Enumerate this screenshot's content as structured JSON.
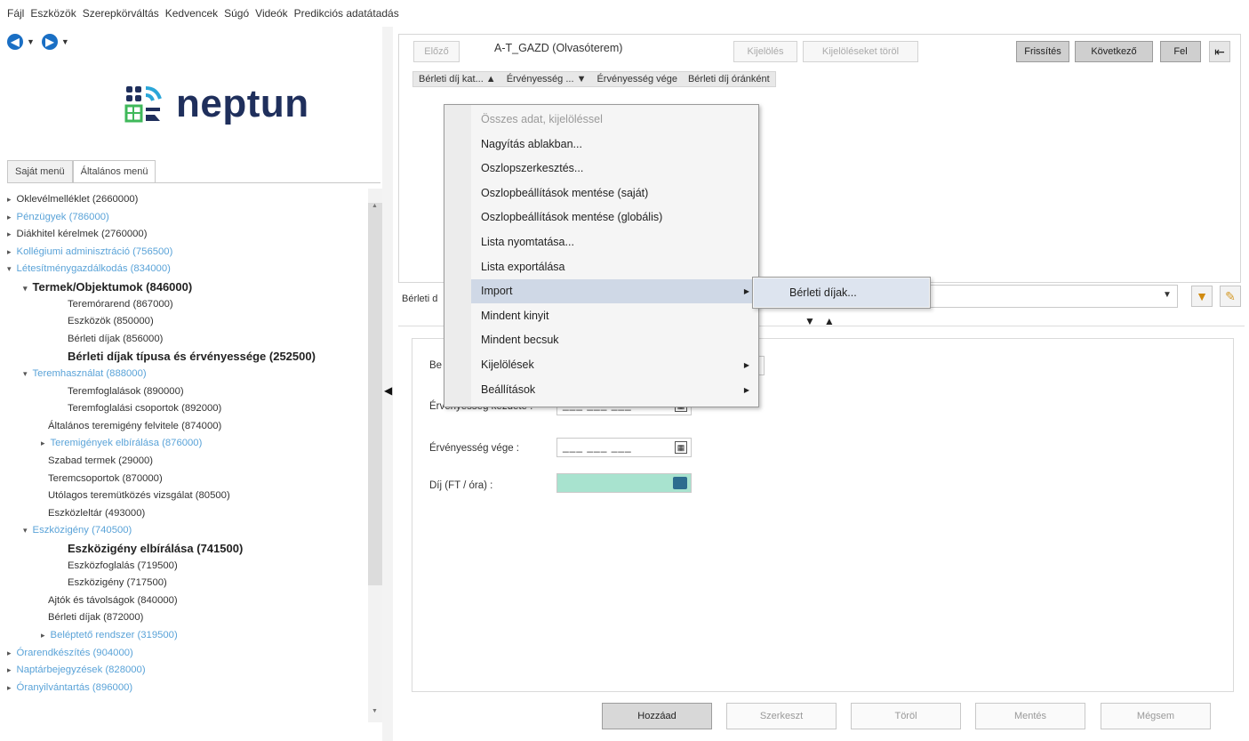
{
  "menubar": [
    "Fájl",
    "Eszközök",
    "Szerepkörváltás",
    "Kedvencek",
    "Súgó",
    "Videók",
    "Predikciós adatátadás"
  ],
  "logo": {
    "text": "neptun"
  },
  "tabs": [
    "Saját menü",
    "Általános menü"
  ],
  "tree": [
    {
      "label": "Oklevélmelléklet (2660000)",
      "style": "normal",
      "arrow": "▸"
    },
    {
      "label": "Pénzügyek (786000)",
      "style": "link",
      "arrow": "▸"
    },
    {
      "label": "Diákhitel kérelmek (2760000)",
      "style": "normal",
      "arrow": "▸"
    },
    {
      "label": "Kollégiumi adminisztráció (756500)",
      "style": "link",
      "arrow": "▸"
    },
    {
      "label": "Létesítménygazdálkodás (834000)",
      "style": "link",
      "arrow": "▾"
    },
    {
      "label": "Termek/Objektumok (846000)",
      "style": "bold",
      "arrow": "▾"
    },
    {
      "label": "Teremórarend (867000)",
      "style": "normal",
      "arrow": ""
    },
    {
      "label": "Eszközök (850000)",
      "style": "normal",
      "arrow": ""
    },
    {
      "label": "Bérleti díjak (856000)",
      "style": "normal",
      "arrow": ""
    },
    {
      "label": "Bérleti díjak típusa és érvényessége (252500)",
      "style": "bold",
      "arrow": ""
    },
    {
      "label": "Teremhasználat (888000)",
      "style": "link",
      "arrow": "▾"
    },
    {
      "label": "Teremfoglalások (890000)",
      "style": "normal",
      "arrow": ""
    },
    {
      "label": "Teremfoglalási csoportok (892000)",
      "style": "normal",
      "arrow": ""
    },
    {
      "label": "Általános teremigény felvitele (874000)",
      "style": "normal",
      "arrow": ""
    },
    {
      "label": "Teremigények elbírálása (876000)",
      "style": "link",
      "arrow": "▸"
    },
    {
      "label": "Szabad termek (29000)",
      "style": "normal",
      "arrow": ""
    },
    {
      "label": "Teremcsoportok (870000)",
      "style": "normal",
      "arrow": ""
    },
    {
      "label": "Utólagos teremütközés vizsgálat (80500)",
      "style": "normal",
      "arrow": ""
    },
    {
      "label": "Eszközleltár (493000)",
      "style": "normal",
      "arrow": ""
    },
    {
      "label": "Eszközigény (740500)",
      "style": "link",
      "arrow": "▾"
    },
    {
      "label": "Eszközigény elbírálása (741500)",
      "style": "bold",
      "arrow": ""
    },
    {
      "label": "Eszközfoglalás (719500)",
      "style": "normal",
      "arrow": ""
    },
    {
      "label": "Eszközigény (717500)",
      "style": "normal",
      "arrow": ""
    },
    {
      "label": "Ajtók és távolságok (840000)",
      "style": "normal",
      "arrow": ""
    },
    {
      "label": "Bérleti díjak (872000)",
      "style": "normal",
      "arrow": ""
    },
    {
      "label": "Beléptető rendszer (319500)",
      "style": "link",
      "arrow": "▸"
    },
    {
      "label": "Órarendkészítés (904000)",
      "style": "link",
      "arrow": "▸"
    },
    {
      "label": "Naptárbejegyzések (828000)",
      "style": "link",
      "arrow": "▸"
    },
    {
      "label": "Óranyilvántartás (896000)",
      "style": "link",
      "arrow": "▸"
    }
  ],
  "toolbar": {
    "prev": "Előző",
    "title": "A-T_GAZD (Olvasóterem)",
    "select": "Kijelölés",
    "clear_select": "Kijelöléseket töröl",
    "refresh": "Frissítés",
    "next": "Következő",
    "up": "Fel"
  },
  "grid_columns": [
    "Bérleti díj kat... ▲",
    "Érvényesség ... ▼",
    "Érvényesség vége",
    "Bérleti díj óránként"
  ],
  "filter": {
    "label": "Bérleti d"
  },
  "context_menu": [
    {
      "label": "Összes adat, kijelöléssel",
      "disabled": true,
      "arrow": false
    },
    {
      "label": "Nagyítás ablakban...",
      "disabled": false,
      "arrow": false
    },
    {
      "label": "Oszlopszerkesztés...",
      "disabled": false,
      "arrow": false
    },
    {
      "label": "Oszlopbeállítások mentése (saját)",
      "disabled": false,
      "arrow": false
    },
    {
      "label": "Oszlopbeállítások mentése (globális)",
      "disabled": false,
      "arrow": false
    },
    {
      "label": "Lista nyomtatása...",
      "disabled": false,
      "arrow": false
    },
    {
      "label": "Lista exportálása",
      "disabled": false,
      "arrow": false
    },
    {
      "label": "Import",
      "disabled": false,
      "arrow": true,
      "highlight": true
    },
    {
      "label": "Mindent kinyit",
      "disabled": false,
      "arrow": false
    },
    {
      "label": "Mindent becsuk",
      "disabled": false,
      "arrow": false
    },
    {
      "label": "Kijelölések",
      "disabled": false,
      "arrow": true
    },
    {
      "label": "Beállítások",
      "disabled": false,
      "arrow": true
    }
  ],
  "submenu": {
    "item": "Bérleti díjak..."
  },
  "form": {
    "label1": "Be",
    "label2": "Érvényesség kezdete :",
    "label3": "Érvényesség vége :",
    "label4": "Díj (FT / óra) :",
    "date_mask": "___ ___ ___"
  },
  "bottom_buttons": {
    "add": "Hozzáad",
    "edit": "Szerkeszt",
    "delete": "Töröl",
    "save": "Mentés",
    "cancel": "Mégsem"
  }
}
